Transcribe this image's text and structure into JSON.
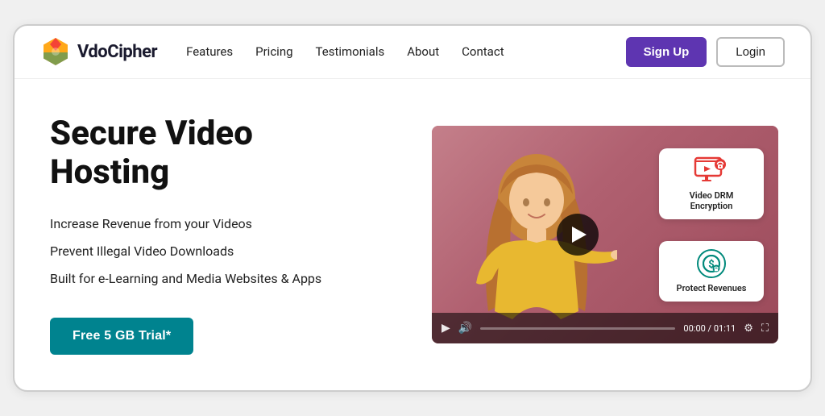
{
  "brand": {
    "name": "VdoCipher"
  },
  "nav": {
    "items": [
      {
        "label": "Features",
        "id": "features"
      },
      {
        "label": "Pricing",
        "id": "pricing"
      },
      {
        "label": "Testimonials",
        "id": "testimonials"
      },
      {
        "label": "About",
        "id": "about"
      },
      {
        "label": "Contact",
        "id": "contact"
      }
    ]
  },
  "header": {
    "signup_label": "Sign Up",
    "login_label": "Login"
  },
  "hero": {
    "title_line1": "Secure Video",
    "title_line2": "Hosting",
    "features": [
      "Increase Revenue from your Videos",
      "Prevent Illegal Video Downloads",
      "Built for e-Learning and Media Websites & Apps"
    ],
    "cta_label": "Free 5 GB Trial*"
  },
  "video": {
    "card1_label": "Video DRM Encryption",
    "card2_label": "Protect Revenues",
    "time_current": "00:00",
    "time_total": "01:11",
    "play_icon": "▶",
    "pause_icon": "▶",
    "volume_icon": "🔊",
    "settings_icon": "⚙",
    "fullscreen_icon": "⛶"
  }
}
